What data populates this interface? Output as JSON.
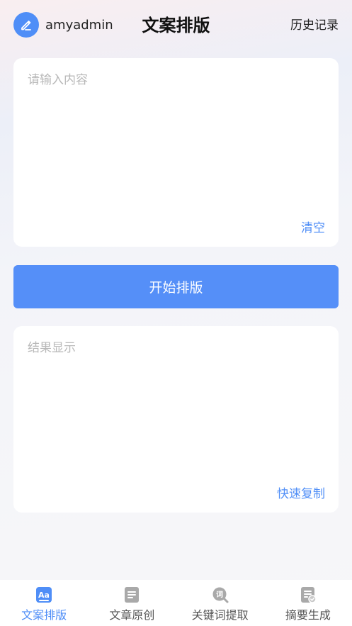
{
  "header": {
    "username": "amyadmin",
    "title": "文案排版",
    "history_label": "历史记录"
  },
  "input_card": {
    "placeholder": "请输入内容",
    "clear_label": "清空",
    "value": ""
  },
  "primary_button": {
    "label": "开始排版"
  },
  "result_card": {
    "placeholder": "结果显示",
    "copy_label": "快速复制"
  },
  "tabbar": {
    "items": [
      {
        "label": "文案排版",
        "icon": "text-format-icon",
        "active": true
      },
      {
        "label": "文章原创",
        "icon": "document-icon",
        "active": false
      },
      {
        "label": "关键词提取",
        "icon": "keyword-search-icon",
        "active": false
      },
      {
        "label": "摘要生成",
        "icon": "summary-icon",
        "active": false
      }
    ]
  },
  "colors": {
    "accent": "#4f8ef7",
    "button": "#558ff8",
    "placeholder": "#b8b8b8",
    "inactive_icon": "#a9a9a9"
  }
}
